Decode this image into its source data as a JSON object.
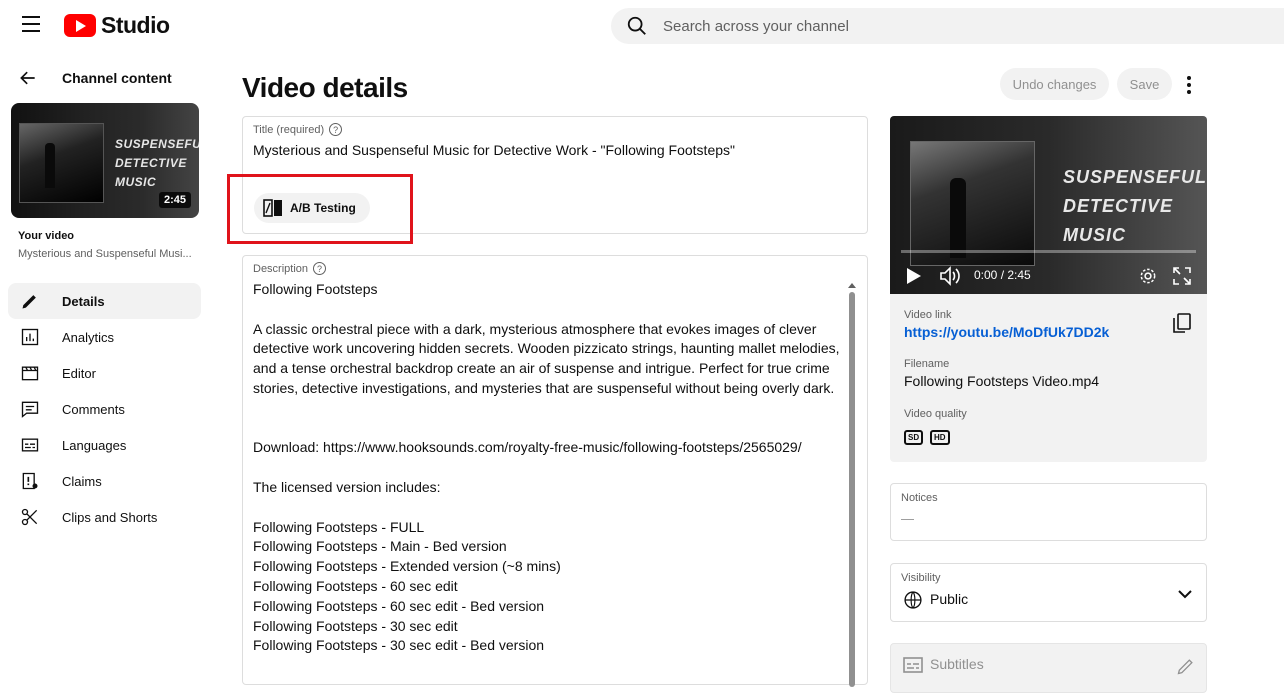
{
  "header": {
    "logo_text": "Studio",
    "search_placeholder": "Search across your channel"
  },
  "sidebar": {
    "back_label": "Channel content",
    "thumbnail_title_lines": [
      "SUSPENSEFUL",
      "DETECTIVE",
      "MUSIC"
    ],
    "thumbnail_duration": "2:45",
    "your_video_label": "Your video",
    "your_video_title": "Mysterious and Suspenseful Musi...",
    "items": [
      {
        "label": "Details",
        "icon": "pencil-icon",
        "active": true
      },
      {
        "label": "Analytics",
        "icon": "analytics-icon",
        "active": false
      },
      {
        "label": "Editor",
        "icon": "editor-icon",
        "active": false
      },
      {
        "label": "Comments",
        "icon": "comments-icon",
        "active": false
      },
      {
        "label": "Languages",
        "icon": "languages-icon",
        "active": false
      },
      {
        "label": "Claims",
        "icon": "claims-icon",
        "active": false
      },
      {
        "label": "Clips and Shorts",
        "icon": "scissors-icon",
        "active": false
      }
    ]
  },
  "main": {
    "page_title": "Video details",
    "undo_label": "Undo changes",
    "save_label": "Save",
    "title_field": {
      "label": "Title (required)",
      "value": "Mysterious and Suspenseful Music for Detective Work - \"Following Footsteps\""
    },
    "ab_testing_label": "A/B Testing",
    "description_field": {
      "label": "Description",
      "lines": [
        "Following Footsteps",
        "",
        "A classic orchestral piece with a dark, mysterious atmosphere that evokes images of clever detective work uncovering hidden secrets. Wooden pizzicato strings, haunting mallet melodies, and a tense orchestral backdrop create an air of suspense and intrigue. Perfect for true crime stories, detective investigations, and mysteries that are suspenseful without being overly dark.",
        "",
        "",
        "Download: https://www.hooksounds.com/royalty-free-music/following-footsteps/2565029/",
        "",
        "The licensed version includes:",
        "",
        "Following Footsteps - FULL",
        "Following Footsteps - Main - Bed version",
        "Following Footsteps - Extended version (~8 mins)",
        "Following Footsteps - 60 sec edit",
        "Following Footsteps - 60 sec edit - Bed version",
        "Following Footsteps - 30 sec edit",
        "Following Footsteps - 30 sec edit - Bed version"
      ]
    }
  },
  "right_panel": {
    "player_title_lines": [
      "SUSPENSEFUL",
      "DETECTIVE",
      "MUSIC"
    ],
    "time_display": "0:00 / 2:45",
    "video_link_label": "Video link",
    "video_link": "https://youtu.be/MoDfUk7DD2k",
    "filename_label": "Filename",
    "filename": "Following Footsteps Video.mp4",
    "quality_label": "Video quality",
    "quality_badges": [
      "SD",
      "HD"
    ],
    "notices_label": "Notices",
    "notices_value": "—",
    "visibility_label": "Visibility",
    "visibility_value": "Public",
    "subtitles_label": "Subtitles"
  },
  "colors": {
    "accent_red": "#ff0000",
    "link_blue": "#065fd4",
    "highlight_box": "#e0131b"
  }
}
